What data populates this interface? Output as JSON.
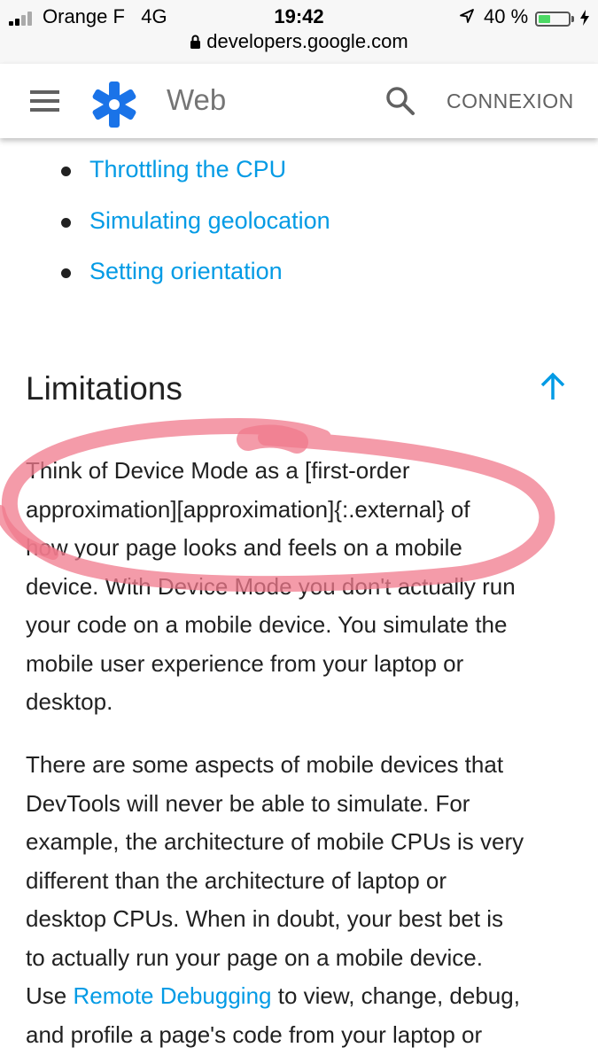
{
  "status_bar": {
    "carrier": "Orange F",
    "network": "4G",
    "time": "19:42",
    "battery_percent": "40 %",
    "battery_level": 0.4,
    "url": "developers.google.com"
  },
  "header": {
    "menu_icon": "hamburger-menu-icon",
    "logo_icon": "web-fundamentals-logo-icon",
    "brand": "Web",
    "search_icon": "search-icon",
    "signin_label": "CONNEXION"
  },
  "toc": {
    "items": [
      {
        "label": "Throttling the CPU"
      },
      {
        "label": "Simulating geolocation"
      },
      {
        "label": "Setting orientation"
      }
    ]
  },
  "section": {
    "heading": "Limitations",
    "back_to_top_icon": "arrow-up-icon",
    "paragraph1": {
      "lines": [
        "Think of Device Mode as a [first-order",
        "approximation][approximation]{:.external} of",
        "how your page looks and feels on a mobile",
        "device. With Device Mode you don't actually run",
        "your code on a mobile device. You simulate the",
        "mobile user experience from your laptop or",
        "desktop."
      ]
    },
    "paragraph2": {
      "lines": [
        "There are some aspects of mobile devices that",
        "DevTools will never be able to simulate. For",
        "example, the architecture of mobile CPUs is very",
        "different than the architecture of laptop or",
        "desktop CPUs. When in doubt, your best bet is",
        "to actually run your page on a mobile device."
      ],
      "line7_before": "Use ",
      "line7_link": "Remote Debugging",
      "line7_after": " to view, change, debug,",
      "line8": "and profile a page's code from your laptop or"
    }
  },
  "colors": {
    "link": "#039be5",
    "text": "#212121",
    "annotation": "#f07a8c",
    "logo": "#1a73e8"
  }
}
